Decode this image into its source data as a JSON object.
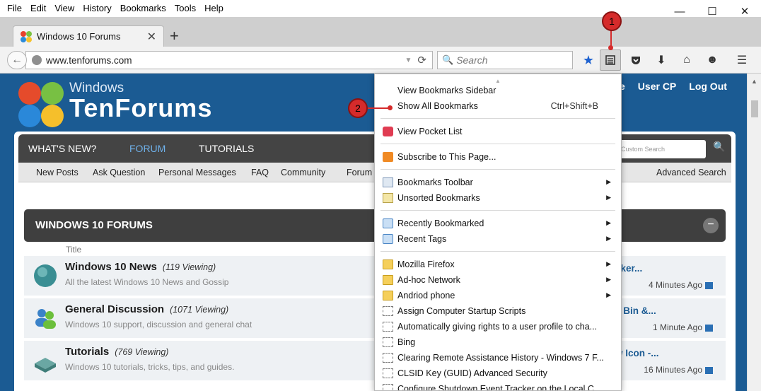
{
  "menubar": {
    "items": [
      "File",
      "Edit",
      "View",
      "History",
      "Bookmarks",
      "Tools",
      "Help"
    ]
  },
  "window_controls": {
    "minimize": "—",
    "maximize": "☐",
    "close": "✕"
  },
  "tab": {
    "title": "Windows 10 Forums",
    "close": "✕",
    "new_tab": "+"
  },
  "navbar": {
    "url": "www.tenforums.com",
    "search_placeholder": "Search"
  },
  "callouts": {
    "one": "1",
    "two": "2"
  },
  "site": {
    "brand_line1": "Windows",
    "brand_line2": "TenForums",
    "top_links": [
      "e",
      "User CP",
      "Log Out"
    ],
    "tabs": [
      "WHAT'S NEW?",
      "FORUM",
      "TUTORIALS"
    ],
    "search_placeholder": "Custom Search",
    "subnav": [
      "New Posts",
      "Ask Question",
      "Personal Messages",
      "FAQ",
      "Community",
      "Forum",
      "Advanced Search"
    ],
    "section_title": "WINDOWS 10 FORUMS",
    "column_title": "Title",
    "forums": [
      {
        "name": "Windows 10 News",
        "viewing": "(119 Viewing)",
        "desc": "All the latest Windows 10 News and Gossip",
        "last": "cker...",
        "time": "4 Minutes Ago"
      },
      {
        "name": "General Discussion",
        "viewing": "(1071 Viewing)",
        "desc": "Windows 10 support, discussion and general chat",
        "last": "e Bin &...",
        "time": "1 Minute Ago"
      },
      {
        "name": "Tutorials",
        "viewing": "(769 Viewing)",
        "desc": "Windows 10 tutorials, tricks, tips, and guides.",
        "last": "w Icon -...",
        "time": "16 Minutes Ago"
      }
    ]
  },
  "bookmarks_menu": {
    "view_sidebar": "View Bookmarks Sidebar",
    "show_all": "Show All Bookmarks",
    "show_all_shortcut": "Ctrl+Shift+B",
    "pocket": "View Pocket List",
    "subscribe": "Subscribe to This Page...",
    "toolbar": "Bookmarks Toolbar",
    "unsorted": "Unsorted Bookmarks",
    "recently_bookmarked": "Recently Bookmarked",
    "recent_tags": "Recent Tags",
    "folders": [
      "Mozilla Firefox",
      "Ad-hoc Network",
      "Andriod phone"
    ],
    "pages": [
      "Assign Computer Startup Scripts",
      "Automatically giving rights to a user profile to cha...",
      "Bing",
      "Clearing Remote Assistance History - Windows 7 F...",
      "CLSID Key (GUID) Advanced Security",
      "Configure Shutdown Event Tracker on the Local C..."
    ]
  }
}
